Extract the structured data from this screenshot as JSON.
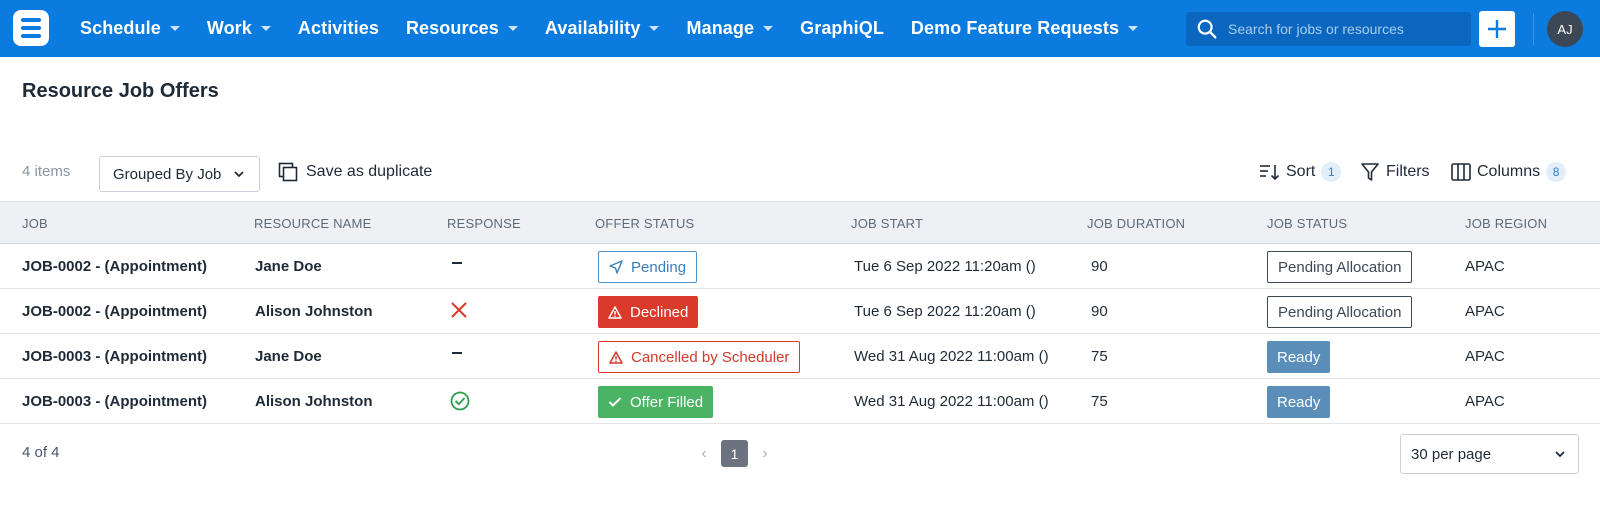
{
  "nav": {
    "items": [
      {
        "label": "Schedule",
        "caret": true
      },
      {
        "label": "Work",
        "caret": true
      },
      {
        "label": "Activities",
        "caret": false
      },
      {
        "label": "Resources",
        "caret": true
      },
      {
        "label": "Availability",
        "caret": true
      },
      {
        "label": "Manage",
        "caret": true
      },
      {
        "label": "GraphiQL",
        "caret": false
      },
      {
        "label": "Demo Feature Requests",
        "caret": true
      }
    ],
    "search_placeholder": "Search for jobs or resources",
    "avatar_initials": "AJ",
    "brand_color": "#0c7be0"
  },
  "page": {
    "title": "Resource Job Offers"
  },
  "toolbar": {
    "count": "4 items",
    "group_by": "Grouped By Job",
    "save_duplicate": "Save as duplicate",
    "sort_label": "Sort",
    "sort_count": "1",
    "filters_label": "Filters",
    "columns_label": "Columns",
    "columns_count": "8"
  },
  "table": {
    "headers": [
      "JOB",
      "RESOURCE NAME",
      "RESPONSE",
      "OFFER STATUS",
      "JOB START",
      "JOB DURATION",
      "JOB STATUS",
      "JOB REGION"
    ],
    "rows": [
      {
        "job": "JOB-0002 - (Appointment)",
        "resource": "Jane Doe",
        "response": "none",
        "offer_status": "Pending",
        "offer_kind": "pending",
        "start": "Tue 6 Sep 2022 11:20am ()",
        "duration": "90",
        "job_status": "Pending Allocation",
        "status_kind": "pending",
        "region": "APAC"
      },
      {
        "job": "JOB-0002 - (Appointment)",
        "resource": "Alison Johnston",
        "response": "declined",
        "offer_status": "Declined",
        "offer_kind": "declined",
        "start": "Tue 6 Sep 2022 11:20am ()",
        "duration": "90",
        "job_status": "Pending Allocation",
        "status_kind": "pending",
        "region": "APAC"
      },
      {
        "job": "JOB-0003 - (Appointment)",
        "resource": "Jane Doe",
        "response": "none",
        "offer_status": "Cancelled by Scheduler",
        "offer_kind": "cancel",
        "start": "Wed 31 Aug 2022 11:00am ()",
        "duration": "75",
        "job_status": "Ready",
        "status_kind": "ready",
        "region": "APAC"
      },
      {
        "job": "JOB-0003 - (Appointment)",
        "resource": "Alison Johnston",
        "response": "accepted",
        "offer_status": "Offer Filled",
        "offer_kind": "filled",
        "start": "Wed 31 Aug 2022 11:00am ()",
        "duration": "75",
        "job_status": "Ready",
        "status_kind": "ready",
        "region": "APAC"
      }
    ]
  },
  "footer": {
    "count": "4 of 4",
    "current_page": "1",
    "per_page": "30 per page"
  }
}
